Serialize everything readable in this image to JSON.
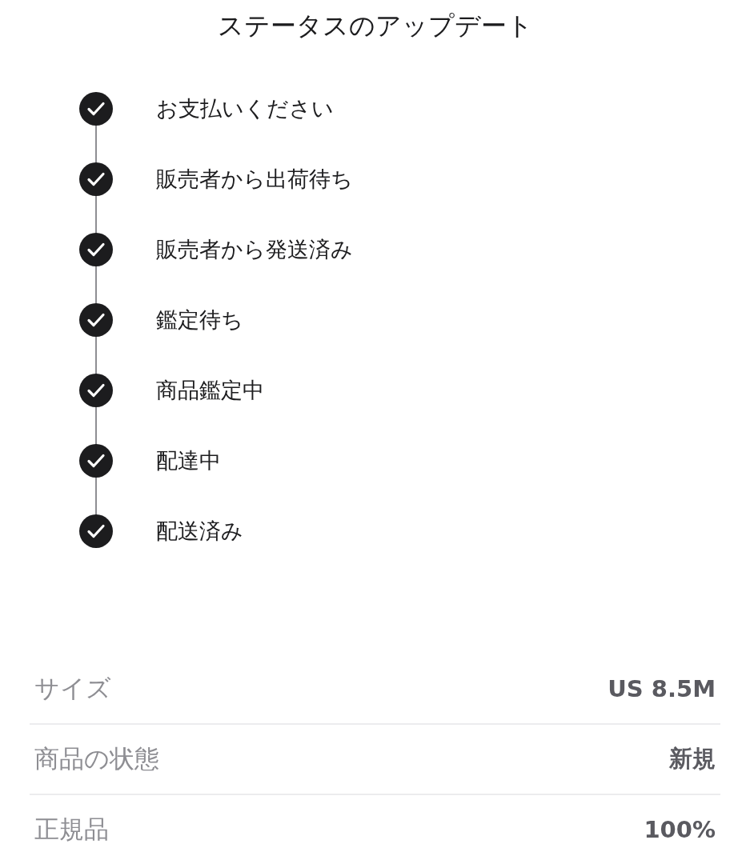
{
  "title": "ステータスのアップデート",
  "steps": [
    {
      "label": "お支払いください",
      "done": true
    },
    {
      "label": "販売者から出荷待ち",
      "done": true
    },
    {
      "label": "販売者から発送済み",
      "done": true
    },
    {
      "label": "鑑定待ち",
      "done": true
    },
    {
      "label": "商品鑑定中",
      "done": true
    },
    {
      "label": "配達中",
      "done": true
    },
    {
      "label": "配送済み",
      "done": true
    }
  ],
  "details": [
    {
      "label": "サイズ",
      "value": "US 8.5M"
    },
    {
      "label": "商品の状態",
      "value": "新規"
    },
    {
      "label": "正規品",
      "value": "100%"
    }
  ]
}
